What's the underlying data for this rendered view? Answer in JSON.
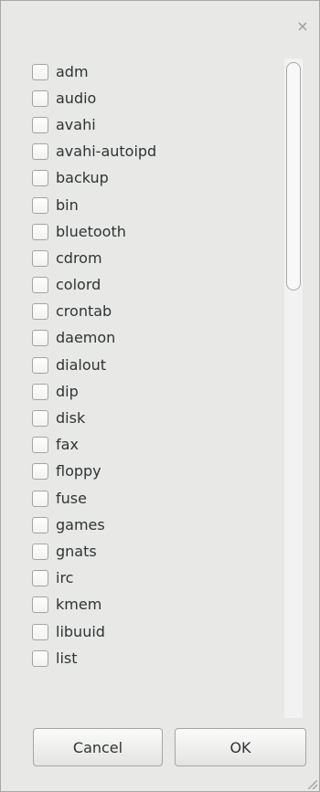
{
  "dialog": {
    "close_glyph": "×",
    "items": [
      {
        "label": "adm",
        "checked": false
      },
      {
        "label": "audio",
        "checked": false
      },
      {
        "label": "avahi",
        "checked": false
      },
      {
        "label": "avahi-autoipd",
        "checked": false
      },
      {
        "label": "backup",
        "checked": false
      },
      {
        "label": "bin",
        "checked": false
      },
      {
        "label": "bluetooth",
        "checked": false
      },
      {
        "label": "cdrom",
        "checked": false
      },
      {
        "label": "colord",
        "checked": false
      },
      {
        "label": "crontab",
        "checked": false
      },
      {
        "label": "daemon",
        "checked": false
      },
      {
        "label": "dialout",
        "checked": false
      },
      {
        "label": "dip",
        "checked": false
      },
      {
        "label": "disk",
        "checked": false
      },
      {
        "label": "fax",
        "checked": false
      },
      {
        "label": "floppy",
        "checked": false
      },
      {
        "label": "fuse",
        "checked": false
      },
      {
        "label": "games",
        "checked": false
      },
      {
        "label": "gnats",
        "checked": false
      },
      {
        "label": "irc",
        "checked": false
      },
      {
        "label": "kmem",
        "checked": false
      },
      {
        "label": "libuuid",
        "checked": false
      },
      {
        "label": "list",
        "checked": false
      }
    ],
    "buttons": {
      "cancel": "Cancel",
      "ok": "OK"
    }
  }
}
